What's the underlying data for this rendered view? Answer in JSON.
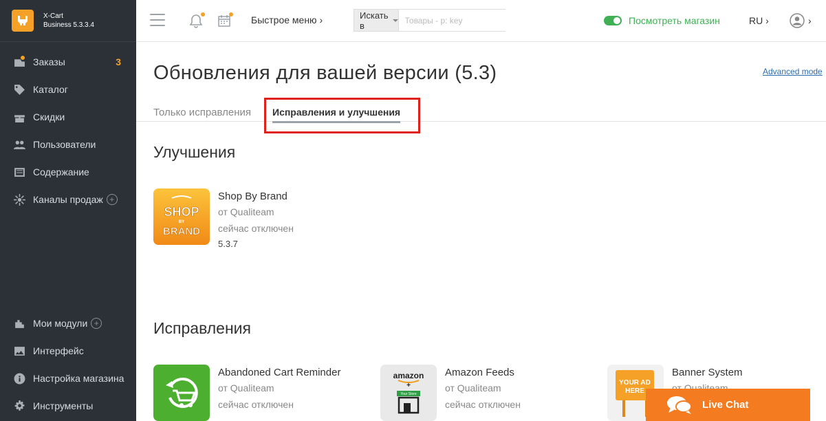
{
  "brand": {
    "name": "X-Cart",
    "edition": "Business 5.3.3.4"
  },
  "sidebar": {
    "items": [
      {
        "label": "Заказы",
        "icon": "orders-icon",
        "badge": "3"
      },
      {
        "label": "Каталог",
        "icon": "tag-icon"
      },
      {
        "label": "Скидки",
        "icon": "gift-icon"
      },
      {
        "label": "Пользователи",
        "icon": "users-icon"
      },
      {
        "label": "Содержание",
        "icon": "content-icon"
      },
      {
        "label": "Каналы продаж",
        "icon": "channels-icon"
      }
    ],
    "bottom_items": [
      {
        "label": "Мои модули",
        "icon": "puzzle-icon"
      },
      {
        "label": "Интерфейс",
        "icon": "image-icon"
      },
      {
        "label": "Настройка магазина",
        "icon": "info-icon"
      },
      {
        "label": "Инструменты",
        "icon": "gear-icon"
      }
    ]
  },
  "header": {
    "quick_menu": "Быстрое меню ›",
    "search": {
      "scope": "Искать в",
      "placeholder": "Товары - p: key"
    },
    "view_store": "Посмотреть магазин",
    "language": "RU ›",
    "user_caret": "›"
  },
  "page": {
    "title": "Обновления для вашей версии (5.3)",
    "advanced_mode": "Advanced mode",
    "tabs": [
      {
        "label": "Только исправления",
        "active": false
      },
      {
        "label": "Исправления и улучшения",
        "active": true
      }
    ]
  },
  "improvements": {
    "title": "Улучшения",
    "modules": [
      {
        "name": "Shop By Brand",
        "vendor": "от Qualiteam",
        "status": "сейчас отключен",
        "version": "5.3.7",
        "logo_text": [
          "SHOP",
          "BY",
          "BRAND"
        ]
      }
    ]
  },
  "fixes": {
    "title": "Исправления",
    "modules": [
      {
        "name": "Abandoned Cart Reminder",
        "vendor": "от Qualiteam",
        "status": "сейчас отключен"
      },
      {
        "name": "Amazon Feeds",
        "vendor": "от Qualiteam",
        "status": "сейчас отключен",
        "logo_text": [
          "amazon",
          "Your Store"
        ]
      },
      {
        "name": "Banner System",
        "vendor": "от Qualiteam",
        "logo_text": [
          "YOUR AD",
          "HERE"
        ]
      }
    ]
  },
  "livechat": {
    "label": "Live Chat"
  },
  "colors": {
    "sidebar_bg": "#2b3137",
    "accent_orange": "#f5a027",
    "green": "#3fb154",
    "highlight_red": "#e0211a",
    "livechat": "#f47b20"
  }
}
